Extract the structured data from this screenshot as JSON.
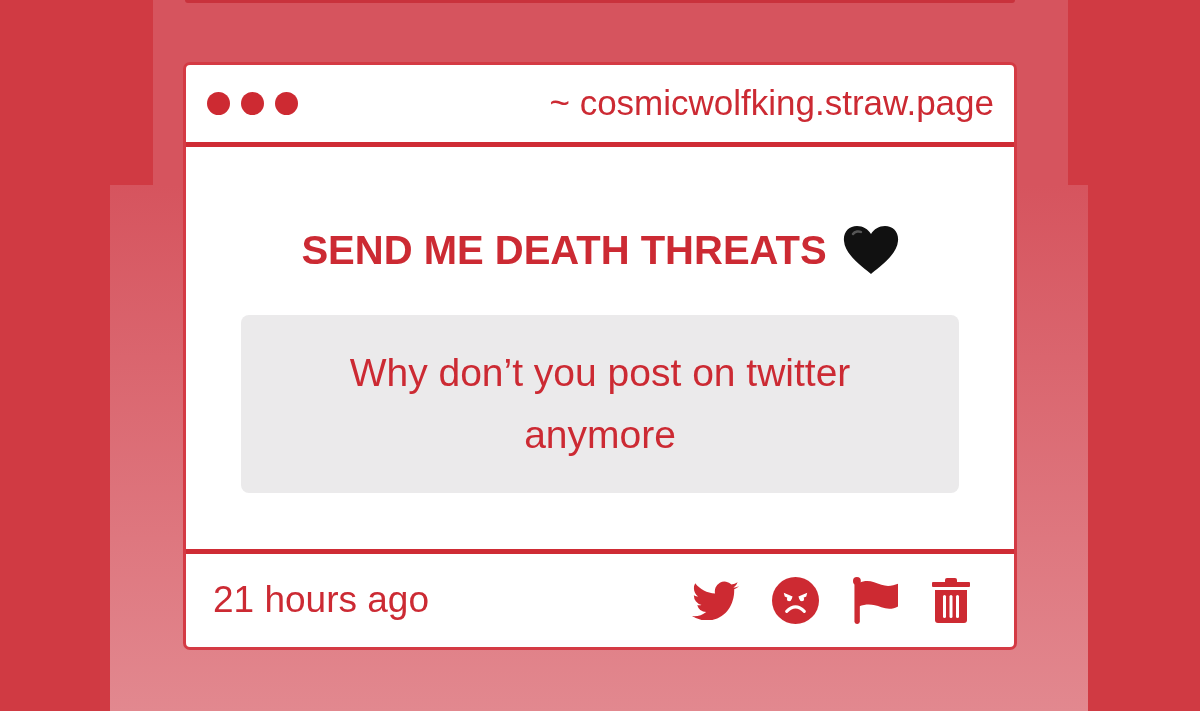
{
  "header": {
    "url": "~ cosmicwolfking.straw.page"
  },
  "prompt": {
    "title": "SEND ME DEATH THREATS"
  },
  "question": {
    "text": "Why don’t you post on twitter anymore"
  },
  "footer": {
    "time": "21 hours ago",
    "actions": [
      {
        "kind": "bird"
      },
      {
        "kind": "angry"
      },
      {
        "kind": "flag"
      },
      {
        "kind": "trash"
      }
    ]
  }
}
